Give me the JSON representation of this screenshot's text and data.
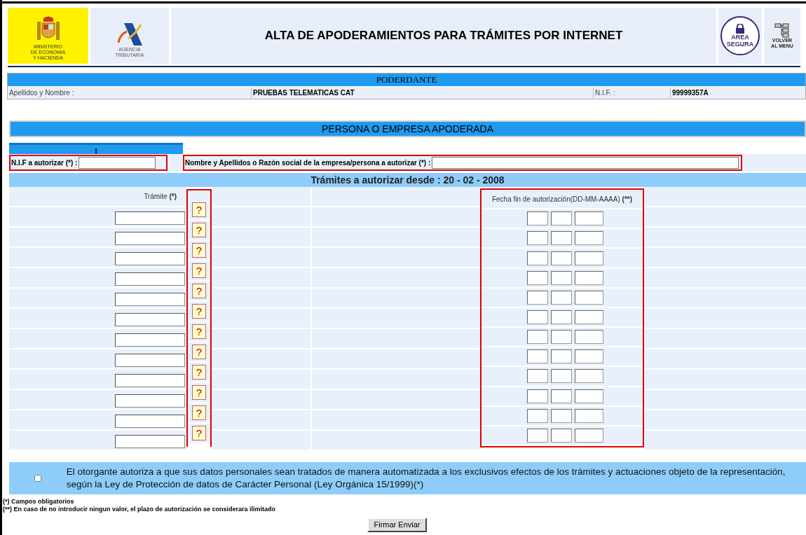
{
  "header": {
    "ministry_logo": [
      "MINISTERIO",
      "DE ECONOMIA",
      "Y HACIENDA"
    ],
    "agency_logo": [
      "AGENCIA",
      "TRIBUTARIA"
    ],
    "title": "ALTA DE APODERAMIENTOS PARA TRÁMITES POR INTERNET",
    "seal": "AREA SEGURA",
    "menu_button": [
      "VOLVER",
      "AL MENU"
    ]
  },
  "poderdante": {
    "heading": "PODERDANTE",
    "name_label": "Apellidos y Nombre :",
    "name_value": "PRUEBAS TELEMATICAS CAT",
    "nif_label": "N.I.F. :",
    "nif_value": "99999357A"
  },
  "apoderada": {
    "heading": "PERSONA O EMPRESA APODERADA",
    "tab": "1",
    "nif_label": "N.I.F a autorizar (*) :",
    "name_label": "Nombre y Apellidos o Razón social de la empresa/persona a autorizar (*) :"
  },
  "tramites": {
    "heading": "Trámites a autorizar desde : 20 - 02 - 2008",
    "tramite_column": {
      "label": "Trámite",
      "mark": "(*)"
    },
    "date_column": {
      "label": "Fecha fin de autorización(DD-MM-AAAA)",
      "mark": "(**)"
    },
    "rows": [
      {
        "help": "?"
      },
      {
        "help": "?"
      },
      {
        "help": "?"
      },
      {
        "help": "?"
      },
      {
        "help": "?"
      },
      {
        "help": "?"
      },
      {
        "help": "?"
      },
      {
        "help": "?"
      },
      {
        "help": "?"
      },
      {
        "help": "?"
      },
      {
        "help": "?"
      },
      {
        "help": "?"
      }
    ]
  },
  "consent": {
    "checked": false,
    "text": "El otorgante autoriza a que sus datos personales sean tratados de manera automatizada a los exclusivos efectos de los trámites y actuaciones objeto de la representación, según la Ley de Protección de datos de Carácter Personal (Ley Orgánica 15/1999)(*)"
  },
  "notes": [
    "(*) Campos obligatorios",
    "(**) En caso de no introducir ningun valor, el plazo de autorización se considerara ilimitado"
  ],
  "submit_button": "Firmar Enviar"
}
